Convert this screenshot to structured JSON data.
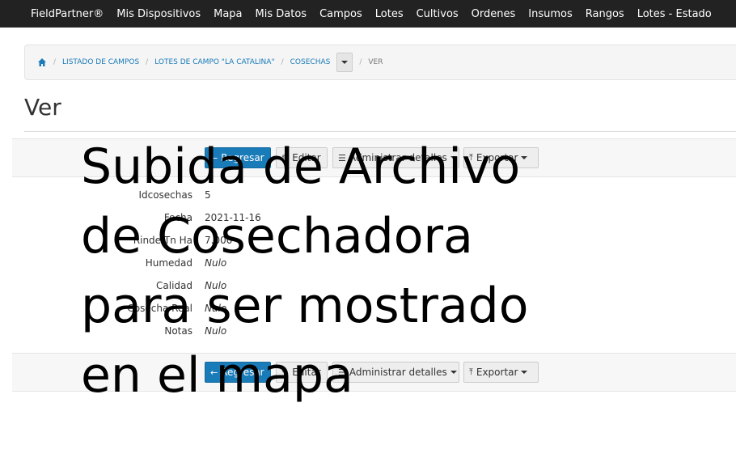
{
  "navbar": {
    "brand": "FieldPartner®",
    "items": [
      "Mis Dispositivos",
      "Mapa",
      "Mis Datos",
      "Campos",
      "Lotes",
      "Cultivos",
      "Ordenes",
      "Insumos",
      "Rangos",
      "Lotes - Estado"
    ]
  },
  "breadcrumb": {
    "items": [
      "LISTADO DE CAMPOS",
      "LOTES DE CAMPO \"LA CATALINA\"",
      "COSECHAS"
    ],
    "active": "VER"
  },
  "page": {
    "title": "Ver"
  },
  "toolbar": {
    "back_label": "Regresar",
    "edit_label": "Editar",
    "manage_label": "Administrar detalles",
    "export_label": "Exportar"
  },
  "details": [
    {
      "label": "Idcosechas",
      "value": "5",
      "null": false
    },
    {
      "label": "Fecha",
      "value": "2021-11-16",
      "null": false
    },
    {
      "label": "Rinde Tn Ha",
      "value": "7.000",
      "null": false
    },
    {
      "label": "Humedad",
      "value": "Nulo",
      "null": true
    },
    {
      "label": "Calidad",
      "value": "Nulo",
      "null": true
    },
    {
      "label": "Cosecha Real",
      "value": "Nulo",
      "null": true
    },
    {
      "label": "Notas",
      "value": "Nulo",
      "null": true
    }
  ],
  "overlay_text": [
    "Subida de Archivo",
    "de Cosechadora",
    "para ser mostrado",
    "en el mapa"
  ],
  "colors": {
    "navbar": "#222222",
    "primary": "#1a7bb9",
    "link": "#1a7bb9"
  }
}
